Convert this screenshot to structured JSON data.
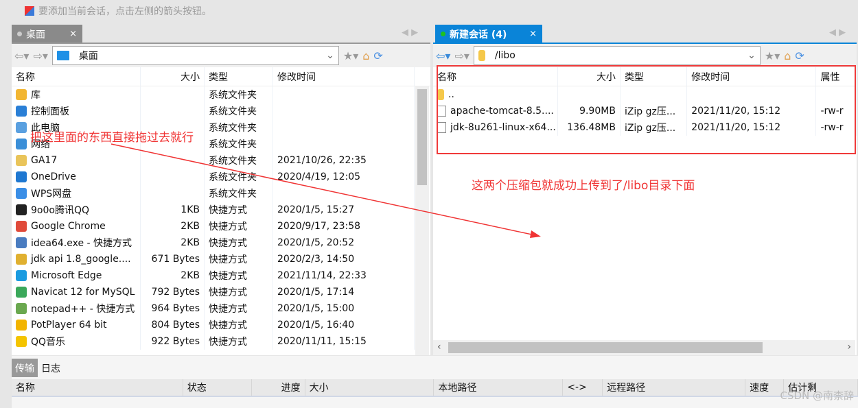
{
  "hint": "要添加当前会话，点击左侧的箭头按钮。",
  "left": {
    "tab_label": "桌面",
    "address": "桌面",
    "columns": [
      "名称",
      "大小",
      "类型",
      "修改时间"
    ],
    "rows": [
      {
        "name": "库",
        "size": "",
        "type": "系统文件夹",
        "date": "",
        "icon": "library-icon",
        "color": "#f2b632"
      },
      {
        "name": "控制面板",
        "size": "",
        "type": "系统文件夹",
        "date": "",
        "icon": "control-panel-icon",
        "color": "#2a7fd6"
      },
      {
        "name": "此电脑",
        "size": "",
        "type": "系统文件夹",
        "date": "",
        "icon": "computer-icon",
        "color": "#5aa0e0"
      },
      {
        "name": "网络",
        "size": "",
        "type": "系统文件夹",
        "date": "",
        "icon": "network-icon",
        "color": "#3b8fd8"
      },
      {
        "name": "GA17",
        "size": "",
        "type": "系统文件夹",
        "date": "2021/10/26, 22:35",
        "icon": "user-folder-icon",
        "color": "#e9c45a"
      },
      {
        "name": "OneDrive",
        "size": "",
        "type": "系统文件夹",
        "date": "2020/4/19, 12:05",
        "icon": "cloud-icon",
        "color": "#1f78d1"
      },
      {
        "name": "WPS网盘",
        "size": "",
        "type": "系统文件夹",
        "date": "",
        "icon": "cloud-icon",
        "color": "#3a8ee6"
      },
      {
        "name": "9o0o腾讯QQ",
        "size": "1KB",
        "type": "快捷方式",
        "date": "2020/1/5, 15:27",
        "icon": "qq-icon",
        "color": "#222"
      },
      {
        "name": "Google Chrome",
        "size": "2KB",
        "type": "快捷方式",
        "date": "2020/9/17, 23:58",
        "icon": "chrome-icon",
        "color": "#e04a3a"
      },
      {
        "name": "idea64.exe - 快捷方式",
        "size": "2KB",
        "type": "快捷方式",
        "date": "2020/1/5, 20:52",
        "icon": "shortcut-icon",
        "color": "#4a7cc0"
      },
      {
        "name": "jdk api 1.8_google....",
        "size": "671 Bytes",
        "type": "快捷方式",
        "date": "2020/2/3, 14:50",
        "icon": "help-file-icon",
        "color": "#e0b030"
      },
      {
        "name": "Microsoft Edge",
        "size": "2KB",
        "type": "快捷方式",
        "date": "2021/11/14, 22:33",
        "icon": "edge-icon",
        "color": "#1a9be0"
      },
      {
        "name": "Navicat 12 for MySQL",
        "size": "792 Bytes",
        "type": "快捷方式",
        "date": "2020/1/5, 17:14",
        "icon": "navicat-icon",
        "color": "#3aa85a"
      },
      {
        "name": "notepad++ - 快捷方式",
        "size": "964 Bytes",
        "type": "快捷方式",
        "date": "2020/1/5, 15:00",
        "icon": "notepad-icon",
        "color": "#6aa84f"
      },
      {
        "name": "PotPlayer 64 bit",
        "size": "804 Bytes",
        "type": "快捷方式",
        "date": "2020/1/5, 16:40",
        "icon": "potplayer-icon",
        "color": "#f2b400"
      },
      {
        "name": "QQ音乐",
        "size": "922 Bytes",
        "type": "快捷方式",
        "date": "2020/11/11, 15:15",
        "icon": "qq-music-icon",
        "color": "#f4c400"
      }
    ]
  },
  "right": {
    "tab_label": "新建会话 (4)",
    "address": "/libo",
    "columns": [
      "名称",
      "大小",
      "类型",
      "修改时间",
      "属性"
    ],
    "rows": [
      {
        "name": "..",
        "size": "",
        "type": "",
        "date": "",
        "attr": "",
        "icon": "folder-icon"
      },
      {
        "name": "apache-tomcat-8.5....",
        "size": "9.90MB",
        "type": "iZip gz压...",
        "date": "2021/11/20, 15:12",
        "attr": "-rw-r",
        "icon": "file-icon"
      },
      {
        "name": "jdk-8u261-linux-x64...",
        "size": "136.48MB",
        "type": "iZip gz压...",
        "date": "2021/11/20, 15:12",
        "attr": "-rw-r",
        "icon": "file-icon"
      }
    ]
  },
  "annotations": {
    "drag_note": "把这里面的东西直接拖过去就行",
    "upload_note": "这两个压缩包就成功上传到了/libo目录下面",
    "color": "#f03434"
  },
  "bottom": {
    "tabs": [
      "传输",
      "日志"
    ],
    "columns": [
      "名称",
      "状态",
      "进度",
      "大小",
      "本地路径",
      "<->",
      "远程路径",
      "速度",
      "估计剩"
    ]
  },
  "watermark": "CSDN @南柰辞"
}
